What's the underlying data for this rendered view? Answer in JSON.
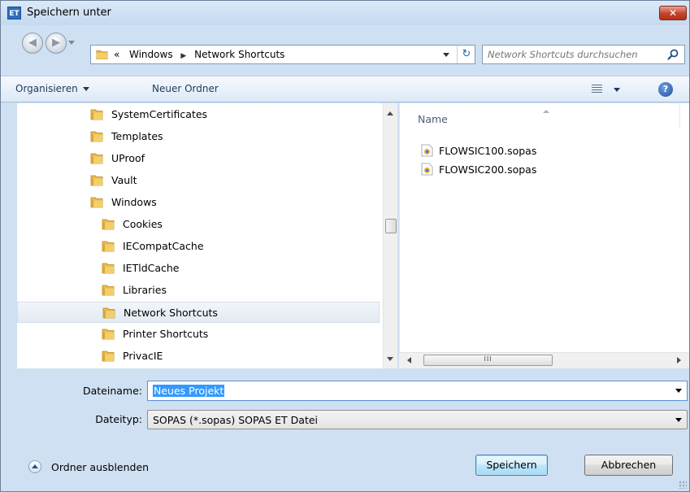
{
  "window": {
    "title": "Speichern unter",
    "app_icon_text": "ET",
    "close_glyph": "✕"
  },
  "nav": {
    "back_glyph": "◀",
    "forward_glyph": "▶",
    "breadcrumb_prefix": "«",
    "breadcrumbs": [
      "Windows",
      "Network Shortcuts"
    ],
    "refresh_glyph": "↻",
    "search_placeholder": "Network Shortcuts durchsuchen"
  },
  "toolbar": {
    "organize_label": "Organisieren",
    "new_folder_label": "Neuer Ordner",
    "help_glyph": "?"
  },
  "tree": {
    "items": [
      {
        "label": "SystemCertificates",
        "level": 0
      },
      {
        "label": "Templates",
        "level": 0
      },
      {
        "label": "UProof",
        "level": 0
      },
      {
        "label": "Vault",
        "level": 0
      },
      {
        "label": "Windows",
        "level": 0
      },
      {
        "label": "Cookies",
        "level": 1
      },
      {
        "label": "IECompatCache",
        "level": 1
      },
      {
        "label": "IETldCache",
        "level": 1
      },
      {
        "label": "Libraries",
        "level": 1
      },
      {
        "label": "Network Shortcuts",
        "level": 1,
        "selected": true
      },
      {
        "label": "Printer Shortcuts",
        "level": 1
      },
      {
        "label": "PrivacIE",
        "level": 1
      }
    ]
  },
  "files": {
    "column_name": "Name",
    "items": [
      "FLOWSIC100.sopas",
      "FLOWSIC200.sopas"
    ],
    "hscroll_grip": "III"
  },
  "form": {
    "filename_label": "Dateiname:",
    "filename_value": "Neues Projekt",
    "filetype_label": "Dateityp:",
    "filetype_value": "SOPAS (*.sopas) SOPAS ET Datei"
  },
  "footer": {
    "hide_folders_label": "Ordner ausblenden",
    "save_label": "Speichern",
    "cancel_label": "Abbrechen"
  },
  "colors": {
    "chrome": "#cfe0f2",
    "selection": "#3399ff",
    "folder": "#e9b94b",
    "close_button": "#c3432b"
  }
}
